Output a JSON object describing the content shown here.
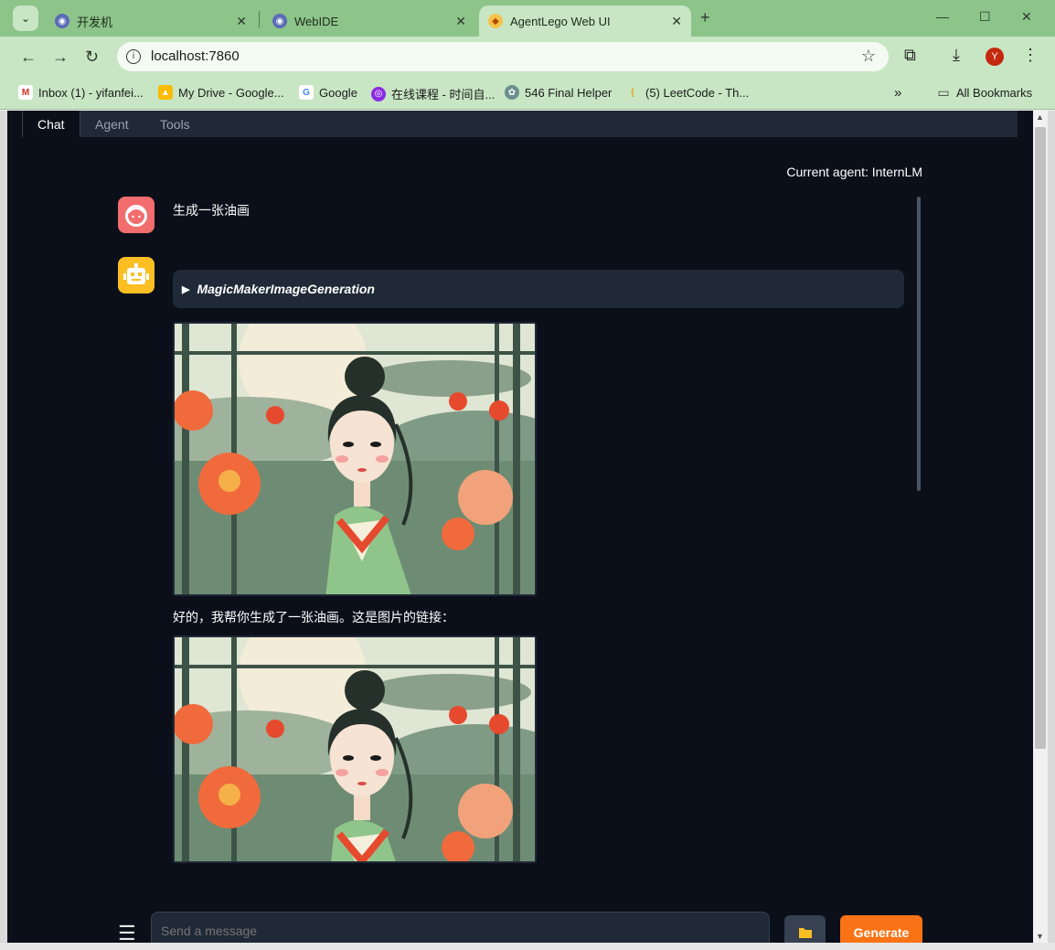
{
  "browser": {
    "tabs": [
      {
        "title": "开发机",
        "active": false
      },
      {
        "title": "WebIDE",
        "active": false
      },
      {
        "title": "AgentLego Web UI",
        "active": true
      }
    ],
    "url": "localhost:7860",
    "profile_initial": "Y",
    "bookmarks": [
      {
        "label": "Inbox (1) - yifanfei..."
      },
      {
        "label": "My Drive - Google..."
      },
      {
        "label": "Google"
      },
      {
        "label": "在线课程 - 时间自..."
      },
      {
        "label": "546 Final Helper"
      },
      {
        "label": "(5) LeetCode - Th..."
      }
    ],
    "all_bookmarks": "All Bookmarks"
  },
  "app": {
    "tabs": [
      "Chat",
      "Agent",
      "Tools"
    ],
    "current_agent": "Current agent: InternLM",
    "user_message": "生成一张油画",
    "tool_call": "MagicMakerImageGeneration",
    "assistant_reply": "好的，我帮你生成了一张油画。这是图片的链接：",
    "input_placeholder": "Send a message",
    "generate_label": "Generate"
  },
  "colors": {
    "browser_frame": "#c8e6c4",
    "page_bg": "#0b0f19",
    "accent": "#f97316"
  }
}
